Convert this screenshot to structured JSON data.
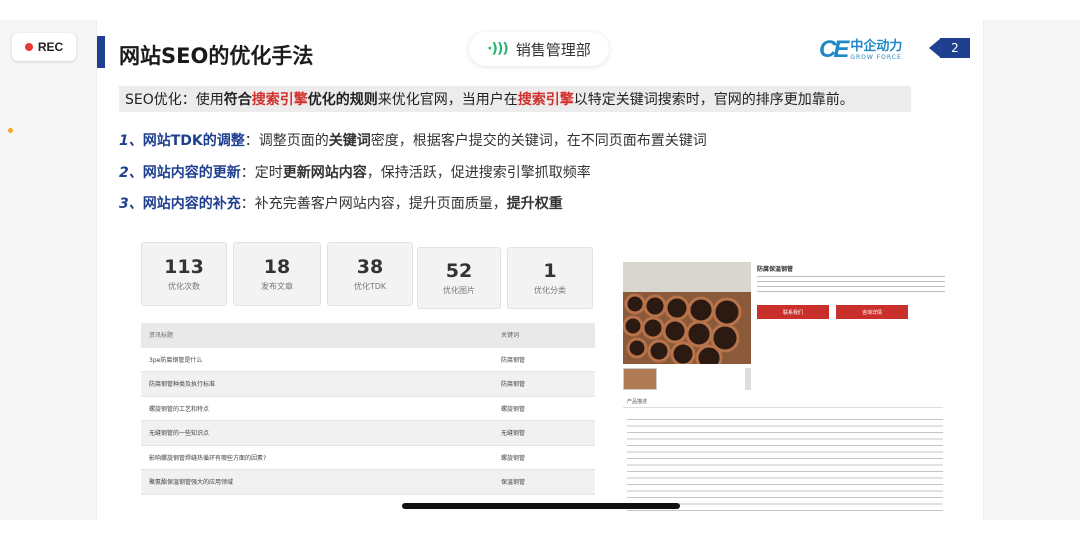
{
  "recorder": {
    "label": "REC",
    "dot_color": "#e53935"
  },
  "slide": {
    "title": "网站SEO的优化手法",
    "accent_color": "#1f3f8f",
    "meeting": {
      "icon": "sound-wave-icon",
      "label": "销售管理部"
    },
    "logo": {
      "mark": "CE",
      "name_cn": "中企动力",
      "name_en": "GROW FORCE",
      "color": "#1e88c9"
    },
    "page_number": "2",
    "intro": {
      "t1": "SEO优化：使用",
      "t2": "符合",
      "t3": "搜索引擎",
      "t4": "优化的规则",
      "t5": "来优化官网，当用户在",
      "t6": "搜索引擎",
      "t7": "以特定关键词搜索时，官网的排序更加靠前。"
    },
    "points": [
      {
        "num": "1、",
        "head": "网站TDK的调整",
        "a": "：调整页面的",
        "b": "关键词",
        "c": "密度，根据客户提交的关键词，在不同页面布置关键词"
      },
      {
        "num": "2、",
        "head": "网站内容的更新",
        "a": "：定时",
        "b": "更新网站内容",
        "c": "，保持活跃，促进搜索引擎抓取频率"
      },
      {
        "num": "3、",
        "head": "网站内容的补充",
        "a": "：补充完善客户网站内容，提升页面质量，",
        "b": "提升权重",
        "c": ""
      }
    ],
    "stats": [
      {
        "value": "113",
        "label": "优化次数"
      },
      {
        "value": "18",
        "label": "发布文章"
      },
      {
        "value": "38",
        "label": "优化TDK"
      },
      {
        "value": "52",
        "label": "优化图片"
      },
      {
        "value": "1",
        "label": "优化分类"
      }
    ],
    "table": {
      "headers": [
        "资讯标题",
        "关键词"
      ],
      "rows": [
        [
          "3pe防腐钢管是什么",
          "防腐钢管"
        ],
        [
          "防腐钢管种类及执行标准",
          "防腐钢管"
        ],
        [
          "螺旋钢管的工艺和特点",
          "螺旋钢管"
        ],
        [
          "无缝钢管的一些知识点",
          "无缝钢管"
        ],
        [
          "影响螺旋钢管焊缝热循环有哪些方面的因素?",
          "螺旋钢管"
        ],
        [
          "聚氨酯保温钢管强大的应用领域",
          "保温钢管"
        ]
      ]
    },
    "product": {
      "title": "防腐保温钢管",
      "btn1": "联系我们",
      "btn2": "咨询详情",
      "tab": "产品描述"
    }
  }
}
